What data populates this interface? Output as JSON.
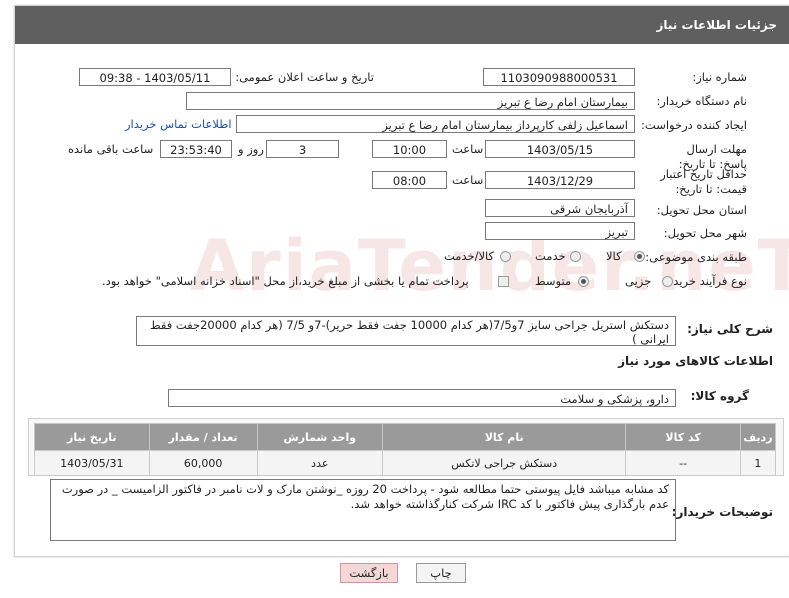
{
  "header": {
    "title": "جزئیات اطلاعات نیاز"
  },
  "fields": {
    "need_number_label": "شماره نیاز:",
    "need_number": "1103090988000531",
    "announce_label": "تاریخ و ساعت اعلان عمومی:",
    "announce_value": "1403/05/11 - 09:38",
    "buyer_org_label": "نام دستگاه خریدار:",
    "buyer_org": "بیمارستان امام رضا  ع  تبریز",
    "creator_label": "ایجاد کننده درخواست:",
    "creator": "اسماعیل زلفی کارپرداز بیمارستان امام رضا  ع  تبریز",
    "contact_link": "اطلاعات تماس خریدار",
    "deadline_label": "مهلت ارسال پاسخ: تا تاریخ:",
    "deadline_date": "1403/05/15",
    "time_label": "ساعت",
    "deadline_time": "10:00",
    "days_value": "3",
    "days_label": "روز و",
    "remaining_time": "23:53:40",
    "remaining_label": "ساعت باقی مانده",
    "price_validity_label": "حداقل تاریخ اعتبار قیمت: تا تاریخ:",
    "price_validity_date": "1403/12/29",
    "price_validity_time": "08:00",
    "province_label": "استان محل تحویل:",
    "province": "آذربایجان شرقی",
    "city_label": "شهر محل تحویل:",
    "city": "تبریز",
    "category_label": "طبقه بندی موضوعی:",
    "category_options": [
      "کالا",
      "خدمت",
      "کالا/خدمت"
    ],
    "purchase_type_label": "نوع فرآیند خرید :",
    "purchase_options": [
      "جزیی",
      "متوسط"
    ],
    "purchase_note": "پرداخت تمام یا بخشی از مبلغ خرید،از محل \"اسناد خزانه اسلامی\" خواهد بود.",
    "description_label": "شرح کلی نیاز:",
    "description": "دستکش استریل جراحی سایز 7و7/5(هر کدام 10000 جفت فقط حریر)-7و 7/5 (هر کدام 20000جفت فقط ایرانی )"
  },
  "goods": {
    "section_title": "اطلاعات کالاهای مورد نیاز",
    "group_label": "گروه کالا:",
    "group_value": "دارو، پزشکی و سلامت",
    "columns": [
      "ردیف",
      "کد کالا",
      "نام کالا",
      "واحد شمارش",
      "تعداد / مقدار",
      "تاریخ نیاز"
    ],
    "rows": [
      {
        "row": "1",
        "code": "--",
        "name": "دستکش جراحی لاتکس",
        "unit": "عدد",
        "qty": "60,000",
        "date": "1403/05/31"
      }
    ]
  },
  "buyer_notes": {
    "label": "توضیحات خریدار:",
    "text": "کد مشابه میباشد فایل پیوستی حتما مطالعه شود - پرداخت 20 روزه _نوشتن مارک و لات نامبر در فاکتور الزامیست _  در صورت عدم بارگذاری پیش فاکتور با کد IRC  شرکت کنارگذاشته خواهد شد."
  },
  "buttons": {
    "print": "چاپ",
    "back": "بازگشت"
  },
  "watermark": "AriaTender.neT",
  "colors": {
    "header_bg": "#5f5f5f",
    "link": "#1a4fb5",
    "table_header": "#9a9a9a",
    "back_button": "#f6d6d6"
  }
}
